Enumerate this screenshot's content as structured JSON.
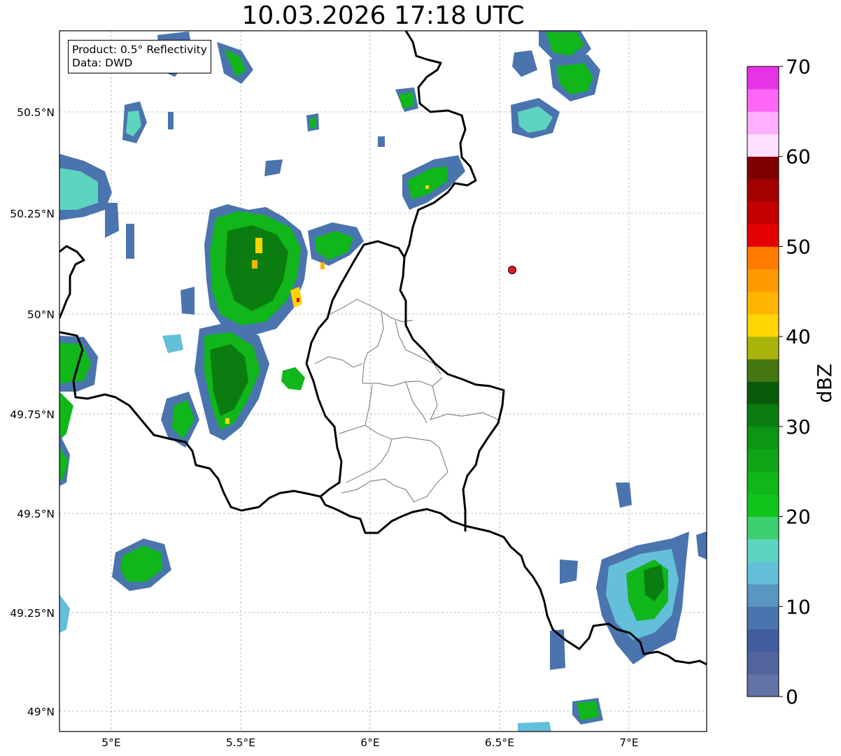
{
  "title": "10.03.2026 17:18 UTC",
  "info_box": {
    "product": "Product: 0.5° Reflectivity",
    "data": "Data: DWD"
  },
  "axes": {
    "lon_ticks": [
      "5°E",
      "5.5°E",
      "6°E",
      "6.5°E",
      "7°E"
    ],
    "lat_ticks": [
      "50.5°N",
      "50.25°N",
      "50°N",
      "49.75°N",
      "49.5°N",
      "49.25°N",
      "49°N"
    ],
    "gridlines": "dashed gray"
  },
  "marker": {
    "name": "radar-site",
    "color": "#e41a1c",
    "lon": 6.55,
    "lat": 50.11
  },
  "colorbar": {
    "label": "dBZ",
    "min": 0,
    "max": 70,
    "tick_labels": [
      "0",
      "10",
      "20",
      "30",
      "40",
      "50",
      "60",
      "70"
    ],
    "colors": [
      "#6373a8",
      "#52649e",
      "#425ea0",
      "#4a74ae",
      "#5a96c2",
      "#64c0da",
      "#5ed4c0",
      "#3ccf6e",
      "#10c41c",
      "#10b61a",
      "#0ea616",
      "#0c9614",
      "#0b7d10",
      "#0a5a0c",
      "#447712",
      "#aab30a",
      "#ffd500",
      "#ffb500",
      "#ff9900",
      "#ff7c00",
      "#e30000",
      "#c50000",
      "#a30000",
      "#800000",
      "#ffe0ff",
      "#ffaffe",
      "#ff66f5",
      "#e633e6"
    ]
  },
  "map_legend": {
    "borders": "national borders in black, cantonal borders in gray",
    "colors": {
      "weak": "#4a74ae",
      "light": "#64c0da",
      "moderate": "#10b61a",
      "strong": "#0b7d10",
      "heavy": "#ffd500",
      "intense": "#e30000"
    }
  }
}
